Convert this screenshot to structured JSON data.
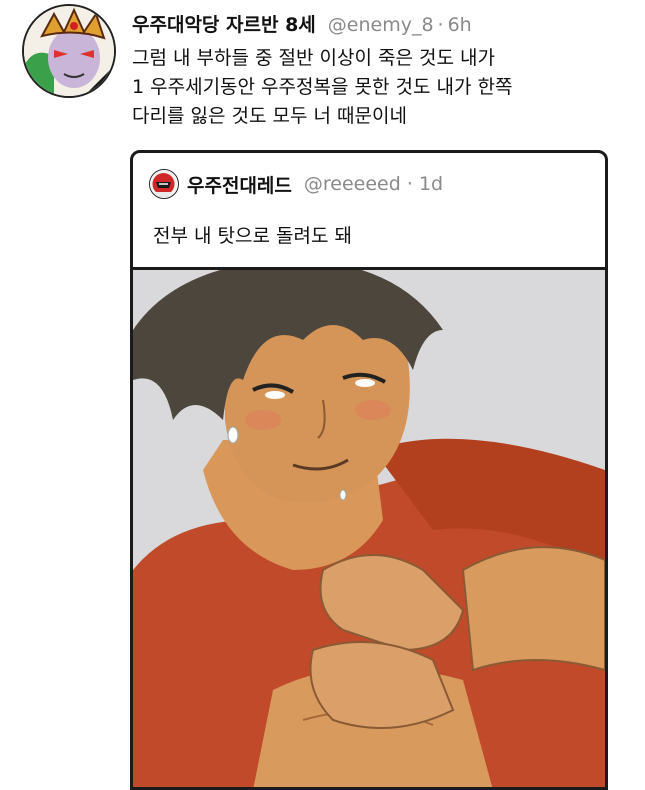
{
  "tweet": {
    "display_name": "우주대악당 자르반 8세",
    "handle": "@enemy_8",
    "separator": "·",
    "time": "6h",
    "text_lines": [
      "그럼 내 부하들 중 절반 이상이 죽은 것도 내가",
      "1 우주세기동안 우주정복을 못한 것도 내가 한쪽",
      "다리를 잃은 것도 모두 너 때문이네"
    ]
  },
  "quoted_tweet": {
    "display_name": "우주전대레드",
    "handle": "@reeeeed",
    "separator": "·",
    "time": "1d",
    "text": "전부 내 탓으로 돌려도 돼"
  },
  "colors": {
    "name_text": "#111111",
    "meta_text": "#8a8a8a",
    "card_border": "#1b1b1b",
    "media_background": "#d9d9db",
    "shirt_red": "#c04a2a",
    "skin": "#d99a5e",
    "hair": "#4d463c"
  },
  "icons": {
    "main_avatar": "villain-avatar-illustration",
    "quoted_avatar": "red-helmet-avatar-illustration"
  }
}
